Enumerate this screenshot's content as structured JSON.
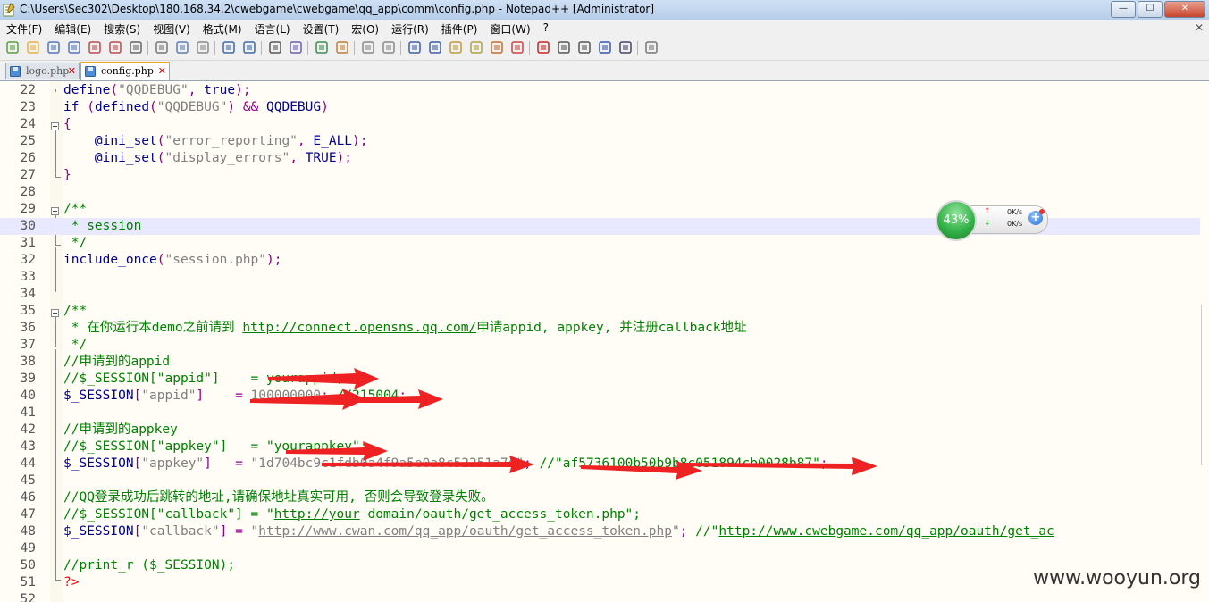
{
  "window": {
    "title": "C:\\Users\\Sec302\\Desktop\\180.168.34.2\\cwebgame\\cwebgame\\qq_app\\comm\\config.php - Notepad++ [Administrator]",
    "buttons": {
      "minimize": "—",
      "maximize": "☐",
      "close": "✕"
    }
  },
  "menu": {
    "items": [
      "文件(F)",
      "编辑(E)",
      "搜索(S)",
      "视图(V)",
      "格式(M)",
      "语言(L)",
      "设置(T)",
      "宏(O)",
      "运行(R)",
      "插件(P)",
      "窗口(W)",
      "?"
    ],
    "close": "✕"
  },
  "toolbar": {
    "icons": [
      "new-file-icon",
      "open-file-icon",
      "save-icon",
      "save-all-icon",
      "close-icon",
      "close-all-icon",
      "print-icon",
      "cut-icon",
      "copy-icon",
      "paste-icon",
      "undo-icon",
      "redo-icon",
      "find-icon",
      "replace-icon",
      "zoom-in-icon",
      "zoom-out-icon",
      "sync-vertical-icon",
      "sync-horizontal-icon",
      "word-wrap-icon",
      "show-all-chars-icon",
      "indent-guide-icon",
      "doc-map-icon",
      "function-list-icon",
      "folder-workspace-icon",
      "record-macro-icon",
      "stop-record-icon",
      "play-macro-icon",
      "run-macro-multiple-icon",
      "save-macro-icon",
      "spell-check-icon"
    ]
  },
  "tabs": [
    {
      "label": "logo.php",
      "active": false
    },
    {
      "label": "config.php",
      "active": true
    }
  ],
  "editor": {
    "lines": [
      {
        "n": "22",
        "tokens": [
          [
            "fn",
            "define"
          ],
          [
            "op",
            "("
          ],
          [
            "str",
            "\"QQDEBUG\""
          ],
          [
            "op",
            ", "
          ],
          [
            "kw",
            "true"
          ],
          [
            "op",
            ");"
          ]
        ]
      },
      {
        "n": "23",
        "tokens": [
          [
            "kw",
            "if"
          ],
          [
            "plain",
            " "
          ],
          [
            "op",
            "("
          ],
          [
            "fn",
            "defined"
          ],
          [
            "op",
            "("
          ],
          [
            "str",
            "\"QQDEBUG\""
          ],
          [
            "op",
            ") && "
          ],
          [
            "const",
            "QQDEBUG"
          ],
          [
            "op",
            ")"
          ]
        ]
      },
      {
        "n": "24",
        "tokens": [
          [
            "op",
            "{"
          ]
        ]
      },
      {
        "n": "25",
        "tokens": [
          [
            "plain",
            "    "
          ],
          [
            "fn",
            "@ini_set"
          ],
          [
            "op",
            "("
          ],
          [
            "str",
            "\"error_reporting\""
          ],
          [
            "op",
            ", "
          ],
          [
            "const",
            "E_ALL"
          ],
          [
            "op",
            ");"
          ]
        ]
      },
      {
        "n": "26",
        "tokens": [
          [
            "plain",
            "    "
          ],
          [
            "fn",
            "@ini_set"
          ],
          [
            "op",
            "("
          ],
          [
            "str",
            "\"display_errors\""
          ],
          [
            "op",
            ", "
          ],
          [
            "const",
            "TRUE"
          ],
          [
            "op",
            ");"
          ]
        ]
      },
      {
        "n": "27",
        "tokens": [
          [
            "op",
            "}"
          ]
        ]
      },
      {
        "n": "28",
        "tokens": []
      },
      {
        "n": "29",
        "tokens": [
          [
            "cmt",
            "/**"
          ]
        ]
      },
      {
        "n": "30",
        "tokens": [
          [
            "cmt",
            " * session"
          ]
        ]
      },
      {
        "n": "31",
        "tokens": [
          [
            "cmt",
            " */"
          ]
        ]
      },
      {
        "n": "32",
        "tokens": [
          [
            "fn",
            "include_once"
          ],
          [
            "op",
            "("
          ],
          [
            "str",
            "\"session.php\""
          ],
          [
            "op",
            ");"
          ]
        ]
      },
      {
        "n": "33",
        "tokens": []
      },
      {
        "n": "34",
        "tokens": []
      },
      {
        "n": "35",
        "tokens": [
          [
            "cmt",
            "/**"
          ]
        ]
      },
      {
        "n": "36",
        "tokens": [
          [
            "cmt",
            " * 在你运行本demo之前请到 "
          ],
          [
            "cmt-url",
            "http://connect.opensns.qq.com/"
          ],
          [
            "cmt",
            "申请appid, appkey, 并注册callback地址"
          ]
        ]
      },
      {
        "n": "37",
        "tokens": [
          [
            "cmt",
            " */"
          ]
        ]
      },
      {
        "n": "38",
        "tokens": [
          [
            "cmt",
            "//申请到的appid"
          ]
        ]
      },
      {
        "n": "39",
        "tokens": [
          [
            "cmt",
            "//$_SESSION[\"appid\"]    = yourappid;"
          ]
        ]
      },
      {
        "n": "40",
        "tokens": [
          [
            "var",
            "$_SESSION"
          ],
          [
            "op",
            "["
          ],
          [
            "str",
            "\"appid\""
          ],
          [
            "op",
            "]    = "
          ],
          [
            "str",
            "100000000"
          ],
          [
            "op",
            "; "
          ],
          [
            "cmt",
            "//215004"
          ],
          [
            "op",
            ";"
          ]
        ]
      },
      {
        "n": "41",
        "tokens": []
      },
      {
        "n": "42",
        "tokens": [
          [
            "cmt",
            "//申请到的appkey"
          ]
        ]
      },
      {
        "n": "43",
        "tokens": [
          [
            "cmt",
            "//$_SESSION[\"appkey\"]   = \"yourappkey\";"
          ]
        ]
      },
      {
        "n": "44",
        "tokens": [
          [
            "var",
            "$_SESSION"
          ],
          [
            "op",
            "["
          ],
          [
            "str",
            "\"appkey\""
          ],
          [
            "op",
            "]   = "
          ],
          [
            "str",
            "\"1d704bc9c1fdb0a4f9a5e0a8c52251a7d\""
          ],
          [
            "op",
            "; "
          ],
          [
            "cmt",
            "//\"af5736100b50b9b8c051894cb0028b87\""
          ],
          [
            "op",
            ";"
          ]
        ]
      },
      {
        "n": "45",
        "tokens": []
      },
      {
        "n": "46",
        "tokens": [
          [
            "cmt",
            "//QQ登录成功后跳转的地址,请确保地址真实可用, 否则会导致登录失败。"
          ]
        ]
      },
      {
        "n": "47",
        "tokens": [
          [
            "cmt",
            "//$_SESSION[\"callback\"] = \""
          ],
          [
            "cmt-url",
            "http://your"
          ],
          [
            "cmt",
            " domain/oauth/get_access_token.php\";"
          ]
        ]
      },
      {
        "n": "48",
        "tokens": [
          [
            "var",
            "$_SESSION"
          ],
          [
            "op",
            "["
          ],
          [
            "str",
            "\"callback\""
          ],
          [
            "op",
            "] = "
          ],
          [
            "str",
            "\""
          ],
          [
            "str-url",
            "http://www.cwan.com/qq_app/oauth/get_access_token.php"
          ],
          [
            "str",
            "\""
          ],
          [
            "op",
            "; "
          ],
          [
            "cmt",
            "//\""
          ],
          [
            "cmt-url",
            "http://www.cwebgame.com/qq_app/oauth/get_ac"
          ]
        ]
      },
      {
        "n": "49",
        "tokens": []
      },
      {
        "n": "50",
        "tokens": [
          [
            "cmt",
            "//print_r ($_SESSION);"
          ]
        ]
      },
      {
        "n": "51",
        "tokens": [
          [
            "php",
            "?>"
          ]
        ]
      },
      {
        "n": "52",
        "tokens": []
      }
    ],
    "current_line": "30"
  },
  "net_widget": {
    "percent": "43%",
    "upload": "0K/s",
    "download": "0K/s"
  },
  "watermark": "www.wooyun.org"
}
